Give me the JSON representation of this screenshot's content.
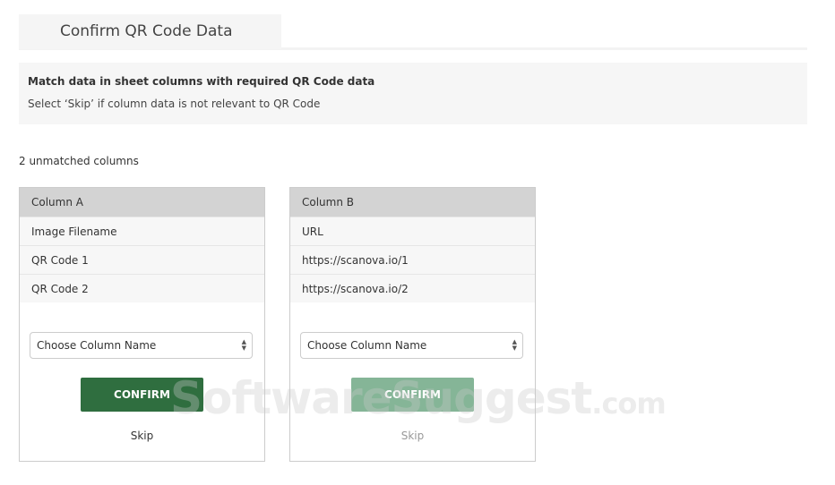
{
  "header": {
    "tab_title": "Confirm QR Code Data"
  },
  "info": {
    "bold": "Match data in sheet columns with required QR Code data",
    "sub": "Select ‘Skip’ if column data is not relevant to QR Code"
  },
  "unmatched": "2 unmatched columns",
  "columns": [
    {
      "header": "Column A",
      "rows": [
        "Image Filename",
        "QR Code 1",
        "QR Code 2"
      ],
      "select": "Choose Column Name",
      "confirm": "CONFIRM",
      "skip": "Skip"
    },
    {
      "header": "Column B",
      "rows": [
        "URL",
        "https://scanova.io/1",
        "https://scanova.io/2"
      ],
      "select": "Choose Column Name",
      "confirm": "CONFIRM",
      "skip": "Skip"
    }
  ],
  "watermark": {
    "main": "SoftwareSuggest",
    ".com": ".com"
  },
  "colors": {
    "confirm": "#2f6e3f",
    "confirm_disabled": "#85b597"
  }
}
